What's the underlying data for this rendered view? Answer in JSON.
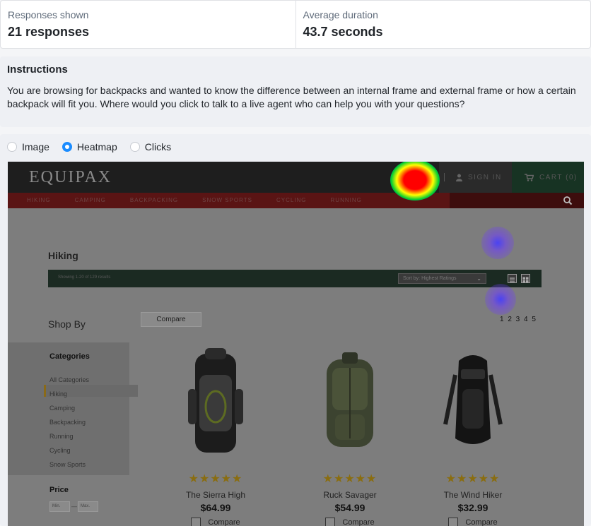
{
  "stats": [
    {
      "label": "Responses shown",
      "value": "21 responses"
    },
    {
      "label": "Average duration",
      "value": "43.7 seconds"
    }
  ],
  "instructions": {
    "title": "Instructions",
    "text": "You are browsing for backpacks and wanted to know the difference between an internal frame and external frame or how a certain backpack will fit you. Where would you click to talk to a live agent who can help you with your questions?"
  },
  "view_modes": {
    "options": [
      "Image",
      "Heatmap",
      "Clicks"
    ],
    "selected": "Heatmap"
  },
  "site": {
    "logo": "EQUIPAX",
    "sign_in": "SIGN IN",
    "cart": "CART (0)",
    "nav": [
      "HIKING",
      "CAMPING",
      "BACKPACKING",
      "SNOW SPORTS",
      "CYCLING",
      "RUNNING"
    ],
    "page_title": "Hiking",
    "results_text": "Showing 1-20 of 129 results",
    "sort_label": "Sort by: Highest Ratings",
    "shop_by": "Shop By",
    "compare_button": "Compare",
    "pages": "1 2 3 4 5",
    "categories_title": "Categories",
    "categories": [
      "All Categories",
      "Hiking",
      "Camping",
      "Backpacking",
      "Running",
      "Cycling",
      "Snow Sports"
    ],
    "active_category": "Hiking",
    "price_title": "Price",
    "price_min_placeholder": "Min.",
    "price_max_placeholder": "Max.",
    "price_separator": "—",
    "products": [
      {
        "name": "The Sierra High",
        "price": "$64.99",
        "rating": 4.5,
        "stars": "★★★★★",
        "compare": "Compare"
      },
      {
        "name": "Ruck Savager",
        "price": "$54.99",
        "rating": 5,
        "stars": "★★★★★",
        "compare": "Compare"
      },
      {
        "name": "The Wind Hiker",
        "price": "$32.99",
        "rating": 4.5,
        "stars": "★★★★★",
        "compare": "Compare"
      }
    ]
  },
  "heatmap_spots": [
    {
      "target": "sign-in-area",
      "intensity": "high"
    },
    {
      "target": "upper-right-blank",
      "intensity": "low"
    },
    {
      "target": "view-toggle-area",
      "intensity": "low"
    }
  ],
  "colors": {
    "accent": "#1a8cff",
    "heat_high": "#ff0000",
    "heat_low": "#5a3cff"
  }
}
